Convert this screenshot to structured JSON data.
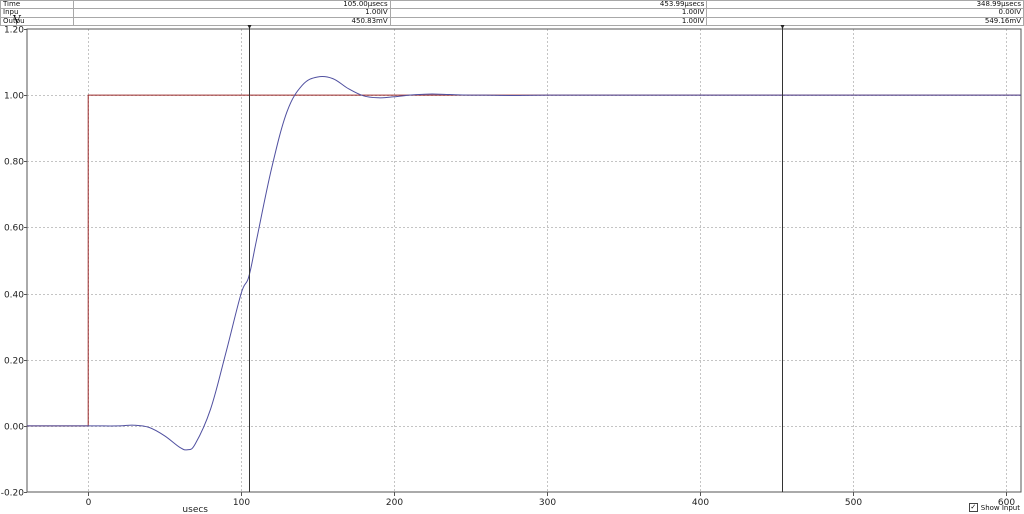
{
  "readout": {
    "rows": [
      {
        "name": "Time",
        "values": [
          "105.00µsecs",
          "453.99µsecs",
          "348.99µsecs"
        ]
      },
      {
        "name": "Inpu",
        "values": [
          "1.00IV",
          "1.00IV",
          "0.00IV"
        ]
      },
      {
        "name": "Outpu",
        "values": [
          "450.83mV",
          "1.00IV",
          "549.16mV"
        ]
      }
    ]
  },
  "show_input": {
    "label": "Show Input",
    "checked": true,
    "check_glyph": "✓"
  },
  "chart_data": {
    "type": "line",
    "title": "",
    "xlabel": "usecs",
    "ylabel": "V",
    "xlim": [
      -40,
      610
    ],
    "ylim": [
      -0.2,
      1.2
    ],
    "x_ticks": [
      0,
      100,
      200,
      300,
      400,
      500,
      600
    ],
    "x_tick_labels": [
      "0",
      "100",
      "200",
      "300",
      "400",
      "500",
      "600"
    ],
    "y_ticks": [
      -0.2,
      0.0,
      0.2,
      0.4,
      0.6,
      0.8,
      1.0,
      1.2
    ],
    "y_tick_labels": [
      "-0.20",
      "0.00",
      "0.20",
      "0.40",
      "0.60",
      "0.80",
      "1.00",
      "1.20"
    ],
    "grid": true,
    "cursors": [
      105.0,
      453.99
    ],
    "series": [
      {
        "color": "#9c2a2a",
        "x": [
          -40,
          0,
          0,
          610
        ],
        "y": [
          0,
          0,
          1,
          1
        ]
      },
      {
        "color": "#5050a0",
        "x": [
          -40,
          0,
          20,
          30,
          40,
          50,
          60,
          65,
          70,
          80,
          90,
          100,
          105,
          110,
          120,
          130,
          140,
          150,
          160,
          170,
          180,
          190,
          200,
          210,
          220,
          230,
          240,
          250,
          260,
          280,
          300,
          400,
          500,
          610
        ],
        "y": [
          0,
          0,
          0,
          0.002,
          -0.005,
          -0.03,
          -0.065,
          -0.072,
          -0.055,
          0.05,
          0.22,
          0.4,
          0.45,
          0.56,
          0.78,
          0.95,
          1.03,
          1.055,
          1.05,
          1.02,
          0.998,
          0.992,
          0.995,
          1.0,
          1.003,
          1.003,
          1.001,
          1.0,
          1.0,
          0.999,
          1.0,
          1.0,
          1.0,
          1.0
        ]
      }
    ]
  }
}
